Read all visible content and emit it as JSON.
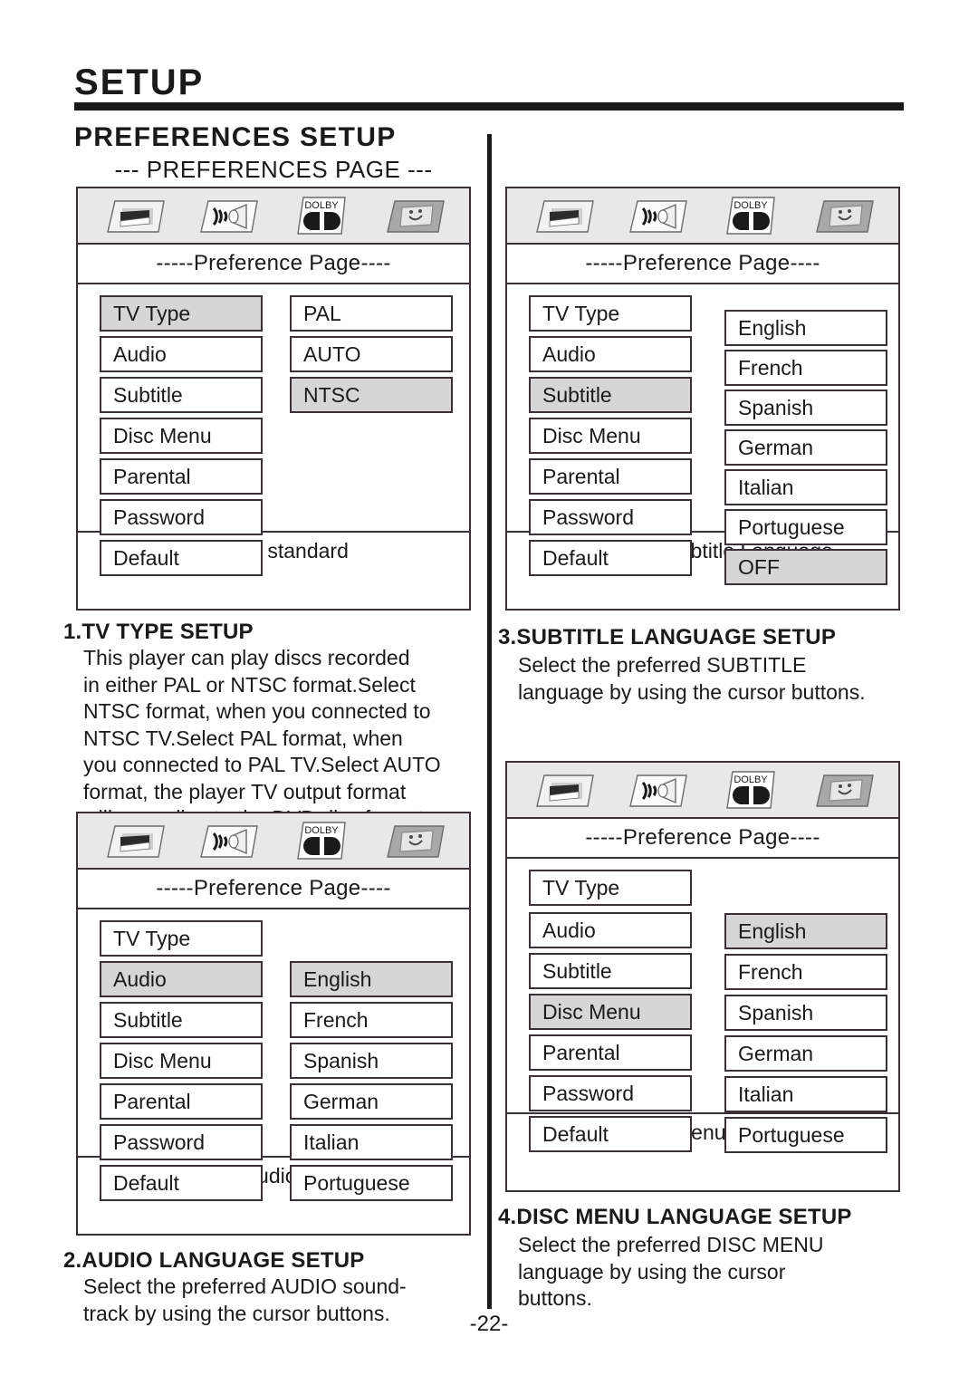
{
  "header": {
    "chapter_title": "SETUP",
    "section_title": "PREFERENCES SETUP",
    "page_heading": "--- PREFERENCES PAGE ---"
  },
  "icons": [
    {
      "name": "general-setup-icon",
      "label": ""
    },
    {
      "name": "audio-setup-icon",
      "label": ""
    },
    {
      "name": "dolby-digital-setup-icon",
      "label": "DOLBY"
    },
    {
      "name": "preferences-setup-icon",
      "label": ""
    }
  ],
  "osd_title": "-----Preference Page----",
  "menu_items": [
    "TV Type",
    "Audio",
    "Subtitle",
    "Disc Menu",
    "Parental",
    "Password",
    "Default"
  ],
  "panels": {
    "tv_type": {
      "title": "-----Preference Page----",
      "menu": [
        "TV Type",
        "Audio",
        "Subtitle",
        "Disc Menu",
        "Parental",
        "Password",
        "Default"
      ],
      "highlighted_menu": "TV Type",
      "values": [
        "PAL",
        "AUTO",
        "NTSC"
      ],
      "highlighted_value": "NTSC",
      "footer": "Set TV standard"
    },
    "subtitle": {
      "title": "-----Preference Page----",
      "menu": [
        "TV Type",
        "Audio",
        "Subtitle",
        "Disc Menu",
        "Parental",
        "Password",
        "Default"
      ],
      "highlighted_menu": "Subtitle",
      "values": [
        "English",
        "French",
        "Spanish",
        "German",
        "Italian",
        "Portuguese",
        "OFF"
      ],
      "highlighted_value": "OFF",
      "footer": "Preferred Subtitle Language"
    },
    "audio": {
      "title": "-----Preference Page----",
      "menu": [
        "TV Type",
        "Audio",
        "Subtitle",
        "Disc Menu",
        "Parental",
        "Password",
        "Default"
      ],
      "highlighted_menu": "Audio",
      "values": [
        "English",
        "French",
        "Spanish",
        "German",
        "Italian",
        "Portuguese"
      ],
      "highlighted_value": "English",
      "footer": "Preferred Audio Language"
    },
    "disc_menu": {
      "title": "-----Preference Page----",
      "menu": [
        "TV Type",
        "Audio",
        "Subtitle",
        "Disc Menu",
        "Parental",
        "Password",
        "Default"
      ],
      "highlighted_menu": "Disc Menu",
      "values": [
        "English",
        "French",
        "Spanish",
        "German",
        "Italian",
        "Portuguese"
      ],
      "highlighted_value": "English",
      "footer": "Preferred Menu Language"
    }
  },
  "sections": {
    "tv_type": {
      "heading": "1.TV TYPE SETUP",
      "lines": [
        "This player can play discs recorded",
        "in either PAL or NTSC format.Select",
        "NTSC format, when you connected to",
        "NTSC TV.Select PAL format, when",
        "you connected to PAL TV.Select AUTO",
        "format, the player TV output format",
        "will according to the DVD disc format.."
      ]
    },
    "audio_language": {
      "heading": "2.AUDIO LANGUAGE SETUP",
      "lines": [
        "Select the preferred AUDIO sound-",
        "track by using the cursor buttons."
      ]
    },
    "subtitle_language": {
      "heading": "3.SUBTITLE LANGUAGE SETUP",
      "lines": [
        "Select the preferred SUBTITLE",
        "language by using the cursor buttons."
      ]
    },
    "disc_menu_language": {
      "heading": "4.DISC MENU LANGUAGE SETUP",
      "lines": [
        "Select the preferred DISC MENU",
        "language by using the cursor",
        "buttons."
      ]
    }
  },
  "footer": {
    "page_number": "-22-"
  },
  "colors": {
    "ink": "#1a1a1a",
    "border": "#3a3038",
    "highlight": "#d6d6d6",
    "iconbar": "#e8e8e8"
  }
}
